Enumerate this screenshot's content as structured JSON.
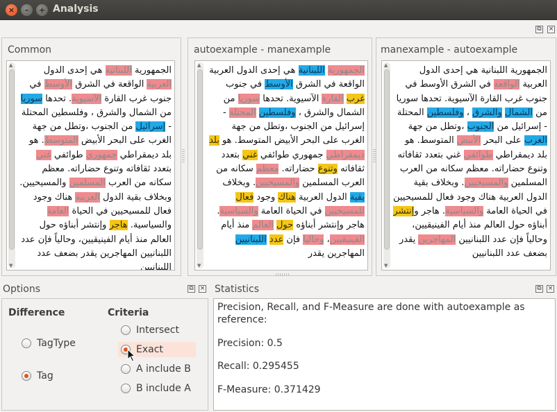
{
  "window": {
    "title": "Analysis",
    "close_glyph": "×",
    "min_glyph": "–",
    "max_glyph": "+"
  },
  "icons": {
    "float": "⧉",
    "close": "×"
  },
  "panes": [
    {
      "title": "Common",
      "runs": [
        {
          "t": "الجمهورية ",
          "h": ""
        },
        {
          "t": "اللبنانية",
          "h": "red"
        },
        {
          "t": " هي إحدى الدول ",
          "h": ""
        },
        {
          "t": "العربية",
          "h": "red"
        },
        {
          "t": " الواقعة في الشرق ",
          "h": ""
        },
        {
          "t": "الأوسط",
          "h": "red"
        },
        {
          "t": " في جنوب غرب القارة ",
          "h": ""
        },
        {
          "t": "الآسيوية",
          "h": "red"
        },
        {
          "t": ". تحدها ",
          "h": ""
        },
        {
          "t": "سوريا",
          "h": "blue"
        },
        {
          "t": " من الشمال والشرق ، وفلسطين المحتلة - ",
          "h": ""
        },
        {
          "t": "إسرائيل",
          "h": "blue"
        },
        {
          "t": " من الجنوب ،وتطل من جهة الغرب على البحر الأبيض ",
          "h": ""
        },
        {
          "t": "المتوسط",
          "h": "red"
        },
        {
          "t": ". هو بلد ديمقراطي ",
          "h": ""
        },
        {
          "t": "جمهوري",
          "h": "red"
        },
        {
          "t": " طوائفي ",
          "h": ""
        },
        {
          "t": "غني",
          "h": "red"
        },
        {
          "t": " بتعدد ثقافاته وتنوع حضاراته. معظم سكانه من العرب ",
          "h": ""
        },
        {
          "t": "المسلمين",
          "h": "red"
        },
        {
          "t": " والمسيحيين. وبخلاف بقية الدول ",
          "h": ""
        },
        {
          "t": "العربية",
          "h": "red"
        },
        {
          "t": " هناك وجود فعال للمسيحيين في الحياة ",
          "h": ""
        },
        {
          "t": "العامة",
          "h": "red"
        },
        {
          "t": " والسياسية. ",
          "h": ""
        },
        {
          "t": "هاجر",
          "h": "yellow"
        },
        {
          "t": " وإنتشر أبناؤه حول العالم منذ أيام الفينيقيين، وحالياً فإن عدد اللبنانيين المهاجرين يقدر بضعف عدد اللبنانيين",
          "h": ""
        }
      ]
    },
    {
      "title": "autoexample - manexample",
      "runs": [
        {
          "t": "الجمهورية",
          "h": "red"
        },
        {
          "t": " ",
          "h": ""
        },
        {
          "t": "اللبنانية",
          "h": "blue"
        },
        {
          "t": " هي إحدى الدول العربية الواقعة في الشرق ",
          "h": ""
        },
        {
          "t": "الأوسط",
          "h": "blue"
        },
        {
          "t": " في جنوب ",
          "h": ""
        },
        {
          "t": "غرب",
          "h": "yellow"
        },
        {
          "t": " ",
          "h": ""
        },
        {
          "t": "القارة",
          "h": "red"
        },
        {
          "t": " الآسيوية. تحدها ",
          "h": ""
        },
        {
          "t": "سوريا",
          "h": "red"
        },
        {
          "t": " من الشمال والشرق ، ",
          "h": ""
        },
        {
          "t": "وفلسطين",
          "h": "blue"
        },
        {
          "t": " ",
          "h": ""
        },
        {
          "t": "المحتلة",
          "h": "red"
        },
        {
          "t": " - إسرائيل من الجنوب ،وتطل من جهة الغرب على البحر الأبيض المتوسط. هو ",
          "h": ""
        },
        {
          "t": "بلد",
          "h": "yellow"
        },
        {
          "t": " ",
          "h": ""
        },
        {
          "t": "ديمقراطي",
          "h": "red"
        },
        {
          "t": " جمهوري طوائفي ",
          "h": ""
        },
        {
          "t": "غني",
          "h": "yellow"
        },
        {
          "t": " بتعدد ثقافاته ",
          "h": ""
        },
        {
          "t": "وتنوع",
          "h": "yellow"
        },
        {
          "t": " حضاراته. ",
          "h": ""
        },
        {
          "t": "معظم",
          "h": "red"
        },
        {
          "t": " سكانه من العرب المسلمين ",
          "h": ""
        },
        {
          "t": "والمسيحيين",
          "h": "red"
        },
        {
          "t": ". وبخلاف ",
          "h": ""
        },
        {
          "t": "بقية",
          "h": "blue"
        },
        {
          "t": " الدول العربية ",
          "h": ""
        },
        {
          "t": "هناك",
          "h": "yellow"
        },
        {
          "t": " وجود ",
          "h": ""
        },
        {
          "t": "فعال",
          "h": "yellow"
        },
        {
          "t": " ",
          "h": ""
        },
        {
          "t": "للمسيحيين",
          "h": "red"
        },
        {
          "t": " في الحياة العامة ",
          "h": ""
        },
        {
          "t": "والسياسية",
          "h": "red"
        },
        {
          "t": ". هاجر وإنتشر أبناؤه ",
          "h": ""
        },
        {
          "t": "حول",
          "h": "yellow"
        },
        {
          "t": " ",
          "h": ""
        },
        {
          "t": "العالم",
          "h": "red"
        },
        {
          "t": " منذ أيام ",
          "h": ""
        },
        {
          "t": "الفينيقيين",
          "h": "red"
        },
        {
          "t": "، ",
          "h": ""
        },
        {
          "t": "وحاليا",
          "h": "red"
        },
        {
          "t": " فإن ",
          "h": ""
        },
        {
          "t": "عدد",
          "h": "yellow"
        },
        {
          "t": " ",
          "h": ""
        },
        {
          "t": "اللبنانيين",
          "h": "blue"
        },
        {
          "t": " المهاجرين يقدر",
          "h": ""
        }
      ]
    },
    {
      "title": "manexample - autoexample",
      "runs": [
        {
          "t": "الجمهورية اللبنانية هي إحدى الدول العربية ",
          "h": ""
        },
        {
          "t": "الواقعة",
          "h": "red"
        },
        {
          "t": " في الشرق الأوسط في جنوب غرب القارة الآسيوية. تحدها سوريا من ",
          "h": ""
        },
        {
          "t": "الشمال",
          "h": "blue"
        },
        {
          "t": " ",
          "h": ""
        },
        {
          "t": "والشرق",
          "h": "blue"
        },
        {
          "t": " ، ",
          "h": ""
        },
        {
          "t": "وفلسطين",
          "h": "blue"
        },
        {
          "t": " المحتلة - إسرائيل من ",
          "h": ""
        },
        {
          "t": "الجنوب",
          "h": "blue"
        },
        {
          "t": " ،وتطل من جهة ",
          "h": ""
        },
        {
          "t": "الغرب",
          "h": "blue"
        },
        {
          "t": " على البحر ",
          "h": ""
        },
        {
          "t": "الأبيض",
          "h": "red"
        },
        {
          "t": " المتوسط. هو بلد ديمقراطي ",
          "h": ""
        },
        {
          "t": "طوائفي",
          "h": "red"
        },
        {
          "t": " غني بتعدد ثقافاته وتنوع حضاراته. معظم سكانه من العرب المسلمين ",
          "h": ""
        },
        {
          "t": "والمسيحيين",
          "h": "red"
        },
        {
          "t": ". وبخلاف بقية الدول العربية هناك وجود فعال للمسيحيين في الحياة العامة ",
          "h": ""
        },
        {
          "t": "والسياسية",
          "h": "red"
        },
        {
          "t": ". هاجر و",
          "h": ""
        },
        {
          "t": "إنتشر",
          "h": "yellow"
        },
        {
          "t": " أبناؤه حول العالم منذ أيام الفينيقيين، وحالياً فإن عدد اللبنانيين ",
          "h": ""
        },
        {
          "t": "المهاجرين",
          "h": "red"
        },
        {
          "t": " يقدر بضعف عدد اللبنانيين",
          "h": ""
        }
      ]
    }
  ],
  "options": {
    "title": "Options",
    "difference": {
      "label": "Difference",
      "items": [
        {
          "label": "TagType",
          "checked": false
        },
        {
          "label": "Tag",
          "checked": true
        }
      ]
    },
    "criteria": {
      "label": "Criteria",
      "items": [
        {
          "label": "Intersect",
          "checked": false
        },
        {
          "label": "Exact",
          "checked": true
        },
        {
          "label": "A include B",
          "checked": false
        },
        {
          "label": "B include A",
          "checked": false
        }
      ]
    }
  },
  "statistics": {
    "title": "Statistics",
    "intro_line1": "Precision, Recall, and F-Measure are done with autoexample as",
    "intro_line2": "reference:",
    "precision": "Precision: 0.5",
    "recall": "Recall: 0.295455",
    "fmeasure": "F-Measure: 0.371429"
  },
  "colors": {
    "highlight_red": "#ef8a8e",
    "highlight_blue": "#22a9e6",
    "highlight_yellow": "#f4c617",
    "accent": "#e0541a"
  }
}
